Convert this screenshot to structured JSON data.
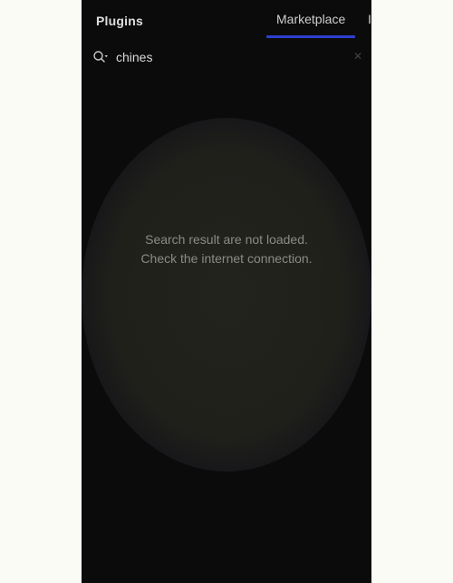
{
  "header": {
    "title": "Plugins",
    "tabs": [
      {
        "label": "Marketplace",
        "active": true
      },
      {
        "label": "I",
        "active": false
      }
    ],
    "active_tab_color": "#2d3fd0"
  },
  "search": {
    "value": "chines",
    "search_icon": "search-icon",
    "clear_icon": "close-icon"
  },
  "message": {
    "line1": "Search result are not loaded.",
    "line2": "Check the internet connection."
  }
}
